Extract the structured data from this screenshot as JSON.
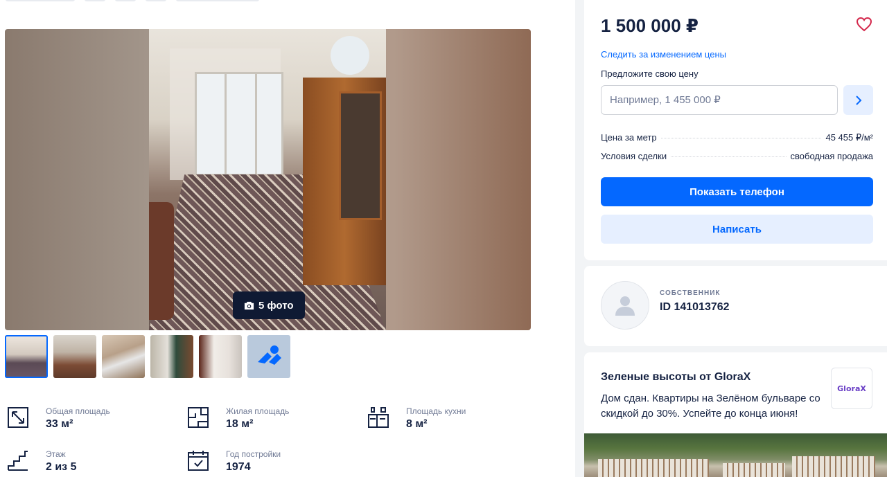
{
  "gallery": {
    "photo_count_label": "5 фото",
    "thumbnails": [
      "photo-1",
      "photo-2",
      "photo-3",
      "photo-4",
      "photo-5",
      "more-photos"
    ]
  },
  "features": [
    {
      "icon": "area-icon",
      "label": "Общая площадь",
      "value": "33 м²"
    },
    {
      "icon": "living-area-icon",
      "label": "Жилая площадь",
      "value": "18 м²"
    },
    {
      "icon": "kitchen-icon",
      "label": "Площадь кухни",
      "value": "8 м²"
    },
    {
      "icon": "stairs-icon",
      "label": "Этаж",
      "value": "2 из 5"
    },
    {
      "icon": "calendar-icon",
      "label": "Год постройки",
      "value": "1974"
    }
  ],
  "price_card": {
    "price": "1 500 000 ₽",
    "track_price_link": "Следить за изменением цены",
    "offer_label": "Предложите свою цену",
    "offer_placeholder": "Например, 1 455 000 ₽",
    "price_per_meter_label": "Цена за метр",
    "price_per_meter_value": "45 455 ₽/м²",
    "deal_terms_label": "Условия сделки",
    "deal_terms_value": "свободная продажа",
    "show_phone_button": "Показать телефон",
    "write_button": "Написать"
  },
  "owner": {
    "type": "СОБСТВЕННИК",
    "id": "ID 141013762"
  },
  "ad": {
    "title": "Зеленые высоты от GloraX",
    "text": "Дом сдан. Квартиры на Зелёном бульваре со скидкой до 30%. Успейте до конца июня!",
    "logo_text": "GloraX"
  },
  "colors": {
    "accent": "#0468ff",
    "accent_light": "#e6efff",
    "text_primary": "#152242",
    "text_secondary": "#707a95",
    "heart": "#d3264a"
  }
}
